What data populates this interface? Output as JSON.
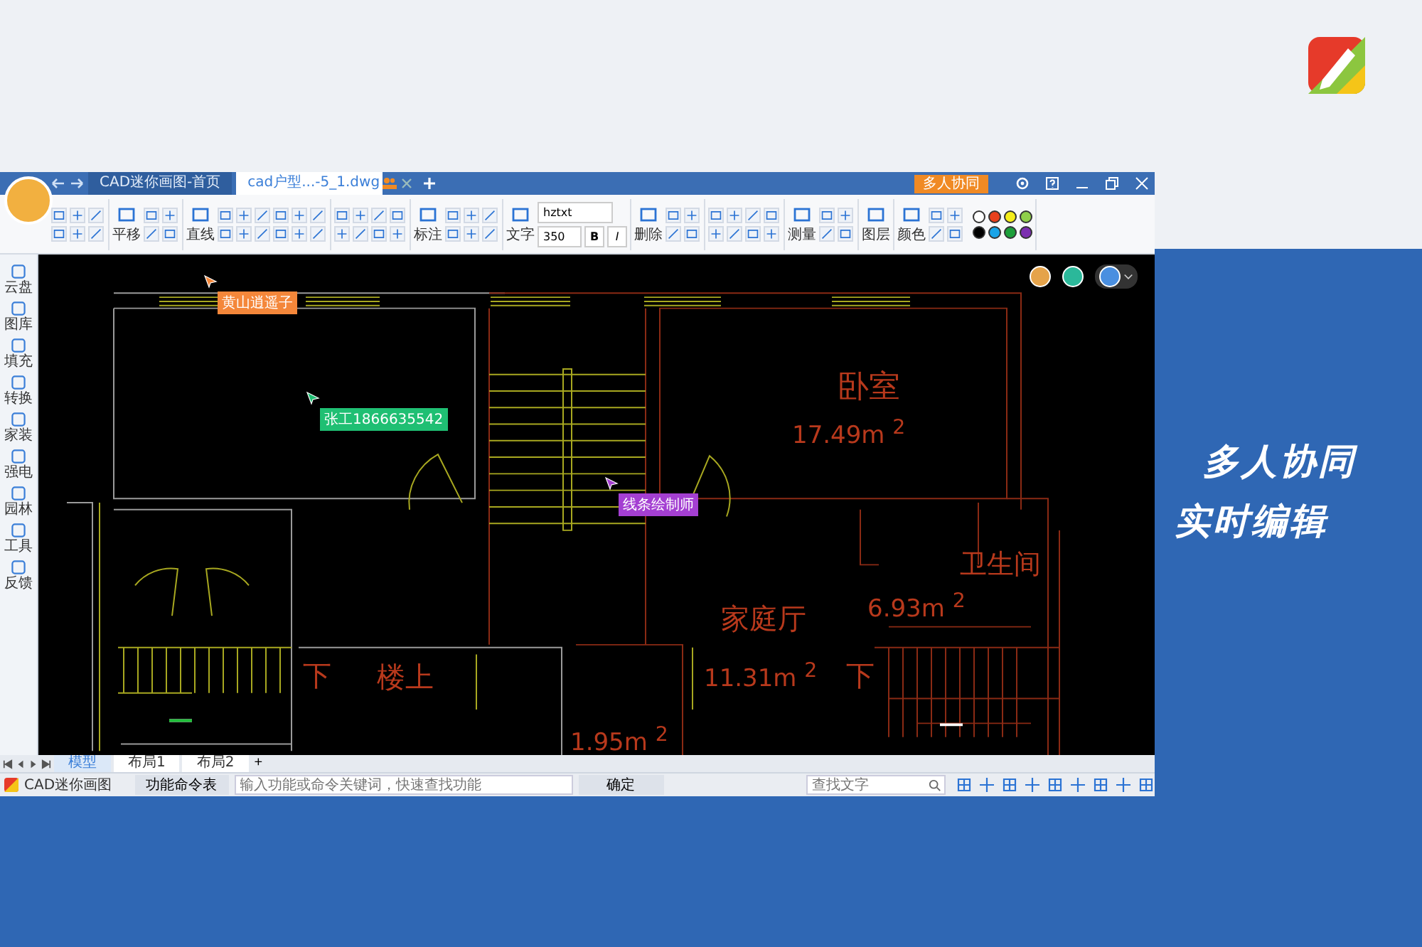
{
  "window": {
    "tabs": [
      {
        "label": "CAD迷你画图-首页",
        "selected": false
      },
      {
        "label": "cad户型...-5_1.dwg",
        "selected": true
      }
    ],
    "collab_button": "多人协同"
  },
  "toolbar": {
    "labels": [
      "平移",
      "直线",
      "标注",
      "文字",
      "删除",
      "测量",
      "图层",
      "颜色"
    ],
    "font": "hztxt",
    "size": "350",
    "bold": "B",
    "italic": "I",
    "colors": [
      {
        "color": "#ffffff"
      },
      {
        "color": "#e8401c"
      },
      {
        "color": "#f5ee1a"
      },
      {
        "color": "#8fcf4a"
      },
      {
        "color": "#000000"
      },
      {
        "color": "#1aa4e8"
      },
      {
        "color": "#1d9f3a"
      },
      {
        "color": "#7c2fb0"
      }
    ]
  },
  "sidebar": {
    "items": [
      {
        "label": "云盘"
      },
      {
        "label": "图库"
      },
      {
        "label": "填充"
      },
      {
        "label": "转换"
      },
      {
        "label": "家装"
      },
      {
        "label": "强电"
      },
      {
        "label": "园林"
      },
      {
        "label": "工具"
      },
      {
        "label": "反馈"
      }
    ]
  },
  "canvas": {
    "room_labels": [
      {
        "text": "卧室"
      },
      {
        "text": "17.49m $^{2}$"
      },
      {
        "text": "卫生间"
      },
      {
        "text": "家庭厅"
      },
      {
        "text": "6.93m $^{2}$"
      },
      {
        "text": "下"
      },
      {
        "text": "楼上"
      },
      {
        "text": "11.31m $^{2}$"
      },
      {
        "text": "下"
      },
      {
        "text": "1.95m $^{2}$"
      }
    ],
    "collaborators": [
      {
        "name": "黄山逍遥子",
        "color": "#f4873a"
      },
      {
        "name": "张工1866635542",
        "color": "#1fbf73"
      },
      {
        "name": "线条绘制师",
        "color": "#a43fd2"
      }
    ]
  },
  "layout_tabs": [
    {
      "label": "模型",
      "selected": true
    },
    {
      "label": "布局1",
      "selected": false
    },
    {
      "label": "布局2",
      "selected": false
    }
  ],
  "add_tab": "+",
  "status_bar": {
    "app_name": "CAD迷你画图",
    "command_table": "功能命令表",
    "command_placeholder": "输入功能或命令关键词，快速查找功能",
    "confirm": "确定",
    "search_placeholder": "查找文字"
  },
  "promo": {
    "lines": [
      "多人协同",
      "实时编辑"
    ]
  }
}
